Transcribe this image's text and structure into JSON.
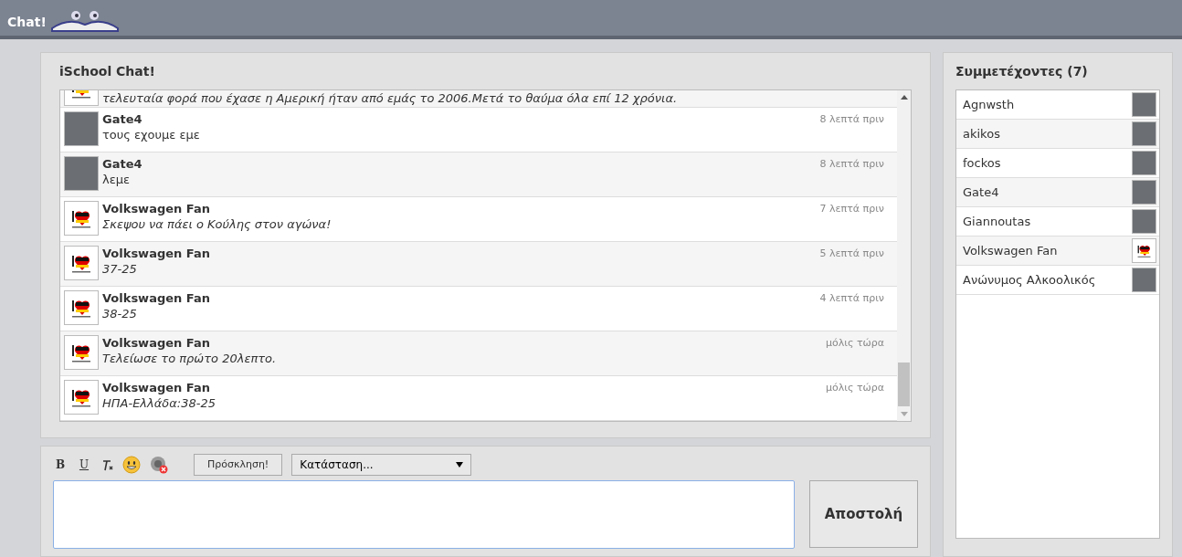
{
  "header": {
    "logo_text": "Chat!"
  },
  "chat": {
    "title": "iSchool Chat!",
    "messages": [
      {
        "kind": "flag",
        "text": "τελευταία φορά που έχασε η Αμερική ήταν από εμάς το 2006.Μετά το θαύμα όλα επί 12 χρόνια.",
        "italic": true
      },
      {
        "kind": "photo",
        "author": "Gate4",
        "time": "8 λεπτά πριν",
        "text": "τους εχουμε εμε",
        "italic": false
      },
      {
        "kind": "photo",
        "author": "Gate4",
        "time": "8 λεπτά πριν",
        "text": "λεμε",
        "italic": false
      },
      {
        "kind": "flag",
        "author": "Volkswagen Fan",
        "time": "7 λεπτά πριν",
        "text": "Σκεψου να πάει ο Κούλης στον αγώνα!",
        "italic": true
      },
      {
        "kind": "flag",
        "author": "Volkswagen Fan",
        "time": "5 λεπτά πριν",
        "text": "37-25",
        "italic": true
      },
      {
        "kind": "flag",
        "author": "Volkswagen Fan",
        "time": "4 λεπτά πριν",
        "text": "38-25",
        "italic": true
      },
      {
        "kind": "flag",
        "author": "Volkswagen Fan",
        "time": "μόλις τώρα",
        "text": "Τελείωσε το πρώτο 20λεπτο.",
        "italic": true
      },
      {
        "kind": "flag",
        "author": "Volkswagen Fan",
        "time": "μόλις τώρα",
        "text": "ΗΠΑ-Ελλάδα:38-25",
        "italic": true
      }
    ]
  },
  "composer": {
    "bold_button": "B",
    "underline_button": "U",
    "invite_button": "Πρόσκληση!",
    "status_select": "Κατάσταση...",
    "send_button": "Αποστολή"
  },
  "participants": {
    "title": "Συμμετέχοντες (7)",
    "users": [
      {
        "name": "Agnwsth",
        "kind": "photo"
      },
      {
        "name": "akikos",
        "kind": "photo"
      },
      {
        "name": "fockos",
        "kind": "photo"
      },
      {
        "name": "Gate4",
        "kind": "photo"
      },
      {
        "name": "Giannoutas",
        "kind": "photo"
      },
      {
        "name": "Volkswagen Fan",
        "kind": "flag"
      },
      {
        "name": "Ανώνυμος Αλκοολικός",
        "kind": "photo"
      }
    ]
  }
}
